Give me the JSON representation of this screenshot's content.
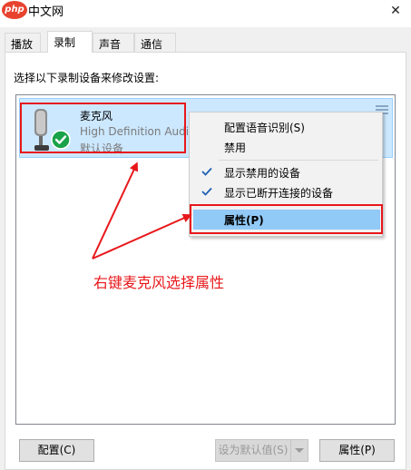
{
  "window": {
    "logo_text": "php",
    "title": "中文网"
  },
  "tabs": [
    {
      "label": "播放"
    },
    {
      "label": "录制"
    },
    {
      "label": "声音"
    },
    {
      "label": "通信"
    }
  ],
  "prompt": "选择以下录制设备来修改设置:",
  "device": {
    "name": "麦克风",
    "description": "High Definition Audio",
    "status": "默认设备",
    "icon": "microphone-icon"
  },
  "context_menu": {
    "items": [
      {
        "label": "配置语音识别(S)",
        "checked": false
      },
      {
        "label": "禁用",
        "checked": false
      },
      {
        "label": "显示禁用的设备",
        "checked": true
      },
      {
        "label": "显示已断开连接的设备",
        "checked": true
      },
      {
        "label": "属性(P)",
        "checked": false,
        "highlighted": true
      }
    ]
  },
  "annotation": {
    "text": "右键麦克风选择属性",
    "color": "#e8171b"
  },
  "buttons": {
    "configure": "配置(C)",
    "set_default": "设为默认值(S)",
    "properties": "属性(P)"
  },
  "colors": {
    "selection": "#cce8ff",
    "menu_highlight": "#91c9f7",
    "default_badge": "#1aa24a"
  }
}
